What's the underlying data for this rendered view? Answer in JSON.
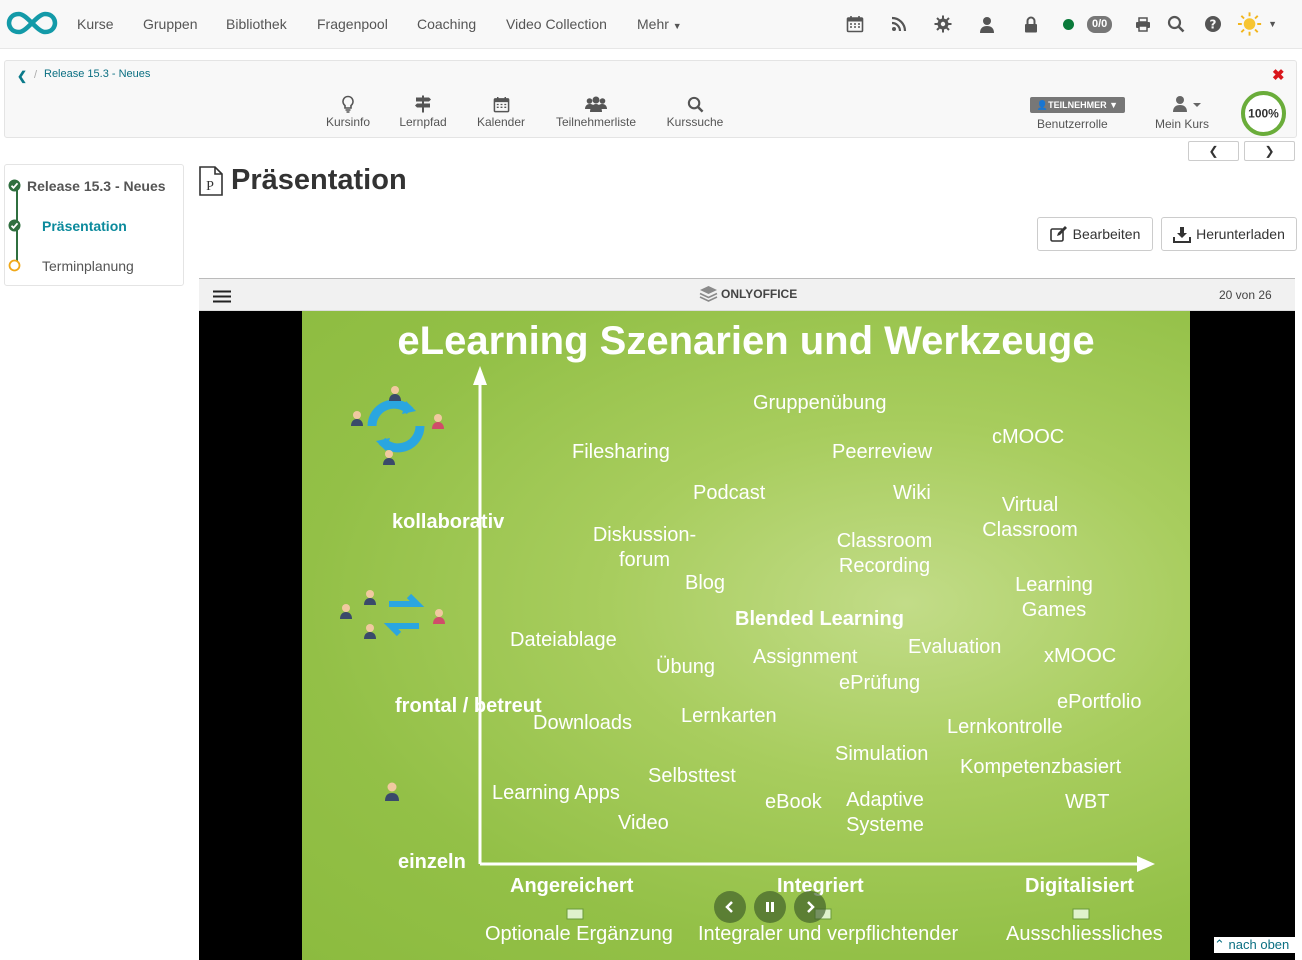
{
  "topnav": {
    "items": [
      "Kurse",
      "Gruppen",
      "Bibliothek",
      "Fragenpool",
      "Coaching",
      "Video Collection",
      "Mehr"
    ],
    "counter": "0/0",
    "icons": [
      "calendar-icon",
      "rss-icon",
      "gear-icon",
      "user-icon",
      "lock-icon",
      "online-status-icon",
      "print-icon",
      "search-icon",
      "help-icon",
      "theme-sun-icon"
    ],
    "colors": {
      "logo": "#139aa8",
      "online": "#0a7a3a"
    }
  },
  "breadcrumb": {
    "current": "Release 15.3 - Neues"
  },
  "course_tools": [
    {
      "label": "Kursinfo",
      "icon": "lightbulb-icon"
    },
    {
      "label": "Lernpfad",
      "icon": "signpost-icon"
    },
    {
      "label": "Kalender",
      "icon": "calendar-icon"
    },
    {
      "label": "Teilnehmerliste",
      "icon": "users-icon"
    },
    {
      "label": "Kurssuche",
      "icon": "search-icon"
    }
  ],
  "role": {
    "badge": "TEILNEHMER",
    "label": "Benutzerrolle"
  },
  "my_course": {
    "label": "Mein Kurs"
  },
  "progress": {
    "value": 100,
    "text": "100%",
    "color": "#6aad3a"
  },
  "menu": {
    "items": [
      {
        "label": "Release 15.3 - Neues",
        "status": "done"
      },
      {
        "label": "Präsentation",
        "status": "done",
        "active": true
      },
      {
        "label": "Terminplanung",
        "status": "open"
      }
    ]
  },
  "main": {
    "title": "Präsentation",
    "edit_label": "Bearbeiten",
    "download_label": "Herunterladen"
  },
  "viewer": {
    "brand": "ONLYOFFICE",
    "page_counter": "20 von 26"
  },
  "slide": {
    "title": "eLearning Szenarien und Werkzeuge",
    "y_labels": [
      "kollaborativ",
      "frontal / betreut",
      "einzeln"
    ],
    "x_labels": [
      "Angereichert",
      "Integriert",
      "Digitalisiert"
    ],
    "x_descriptions": [
      "Optionale Ergänzung",
      "Integraler und verpflichtender",
      "Ausschliessliches"
    ],
    "terms": {
      "gruppenuebung": "Gruppenübung",
      "cmooc": "cMOOC",
      "filesharing": "Filesharing",
      "peerreview": "Peerreview",
      "podcast": "Podcast",
      "wiki": "Wiki",
      "virtual1": "Virtual",
      "virtual2": "Classroom",
      "diskussion1": "Diskussion-",
      "diskussion2": "forum",
      "classroom1": "Classroom",
      "classroom2": "Recording",
      "blog": "Blog",
      "learning1": "Learning",
      "learning2": "Games",
      "blended": "Blended Learning",
      "dateiablage": "Dateiablage",
      "evaluation": "Evaluation",
      "uebung": "Übung",
      "assignment": "Assignment",
      "xmooc": "xMOOC",
      "epruefung": "ePrüfung",
      "eportfolio": "ePortfolio",
      "downloads": "Downloads",
      "lernkarten": "Lernkarten",
      "lernkontrolle": "Lernkontrolle",
      "simulation": "Simulation",
      "kompetenz": "Kompetenzbasiert",
      "selbsttest": "Selbsttest",
      "learningapps": "Learning Apps",
      "ebook": "eBook",
      "adaptive1": "Adaptive",
      "adaptive2": "Systeme",
      "wbt": "WBT",
      "video": "Video"
    }
  },
  "back_to_top": "nach oben"
}
